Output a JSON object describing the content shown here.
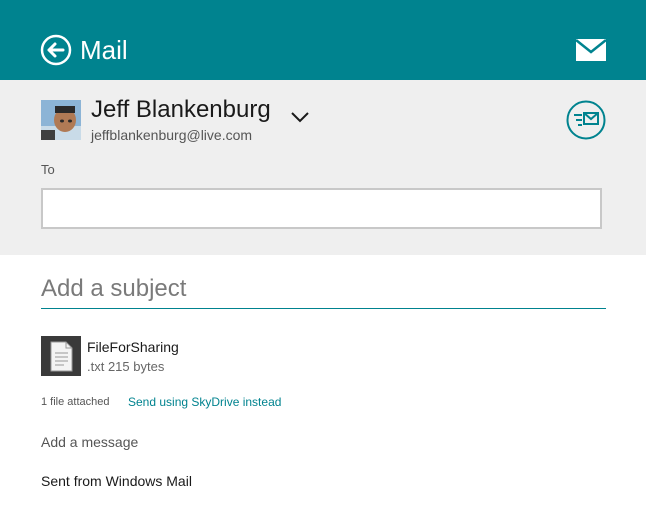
{
  "colors": {
    "accent": "#00838f",
    "header_bg": "#00838f",
    "compose_bg": "#efefef",
    "text": "#1a1a1a",
    "muted": "#555555"
  },
  "header": {
    "title": "Mail",
    "back_icon": "back-arrow-circle-icon",
    "mail_icon": "envelope-icon"
  },
  "sender": {
    "name": "Jeff Blankenburg",
    "email": "jeffblankenburg@live.com",
    "avatar_icon": "avatar-photo",
    "dropdown_icon": "chevron-down-icon",
    "send_icon": "send-mail-icon"
  },
  "to": {
    "label": "To",
    "value": "",
    "placeholder": ""
  },
  "subject": {
    "placeholder": "Add a subject",
    "value": ""
  },
  "attachment": {
    "name": "FileForSharing",
    "meta": ".txt 215 bytes",
    "icon": "text-file-icon",
    "count_text": "1 file attached",
    "skydrive_link": "Send using SkyDrive instead"
  },
  "message": {
    "placeholder": "Add a message",
    "signature": "Sent from Windows Mail"
  }
}
